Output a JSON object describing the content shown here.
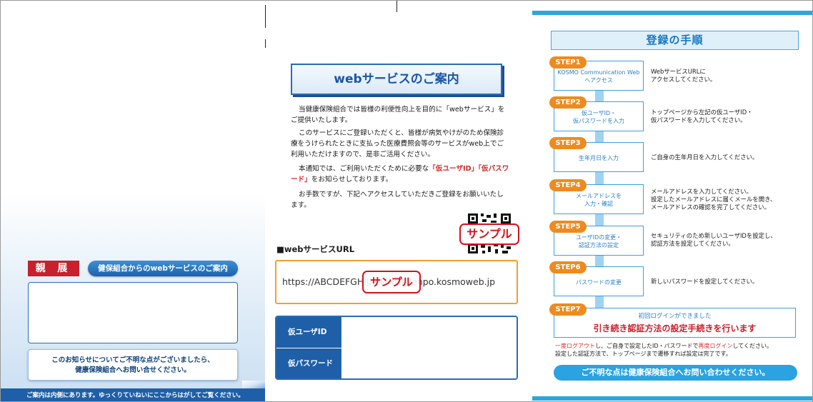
{
  "left_panel": {
    "addressee": "親 展",
    "title_badge": "健保組合からのwebサービスのご案内",
    "notice_line1": "このお知らせについてご不明な点がございましたら、",
    "notice_line2": "健康保険組合へお問い合せください。",
    "footer": "ご案内は内側にあります。ゆっくりていねいにここからはがしてご覧ください。"
  },
  "middle_panel": {
    "title": "webサービスのご案内",
    "paragraph1": "当健康保険組合では皆様の利便性向上を目的に「webサービス」をご提供いたします。",
    "paragraph2": "このサービスにご登録いただくと、皆様が病気やけがのため保険診療をうけられたときに支払った医療費照会等のサービスがweb上でご利用いただけますので、是非ご活用ください。",
    "paragraph3_before": "本通知では、ご利用いただくために必要な",
    "paragraph3_red1": "「仮ユーザID」",
    "paragraph3_red2": "「仮パスワード」",
    "paragraph3_after": "をお知らせしております。",
    "paragraph4": "お手数ですが、下記へアクセスしていただきご登録をお願いいたします。",
    "sample_stamp": "サンプル",
    "url_label": "■webサービスURL",
    "url_value": "https://ABCDEFGHIJKLMNOPkenpo.kosmoweb.jp",
    "temp_user_id_label": "仮ユーザID",
    "temp_password_label": "仮パスワード"
  },
  "right_panel": {
    "title": "登録の手順",
    "steps": [
      {
        "label": "STEP1",
        "box_line1": "KOSMO Communication Web",
        "box_line2": "へアクセス",
        "desc_line1": "WebサービスURLに",
        "desc_line2": "アクセスしてください。",
        "desc_line3": ""
      },
      {
        "label": "STEP2",
        "box_line1": "仮ユーザID・",
        "box_line2": "仮パスワードを入力",
        "desc_line1": "トップページから左記の仮ユーザID・",
        "desc_line2": "仮パスワードを入力してください。",
        "desc_line3": ""
      },
      {
        "label": "STEP3",
        "box_line1": "生年月日を入力",
        "box_line2": "",
        "desc_line1": "ご自身の生年月日を入力してください。",
        "desc_line2": "",
        "desc_line3": ""
      },
      {
        "label": "STEP4",
        "box_line1": "メールアドレスを",
        "box_line2": "入力・確認",
        "desc_line1": "メールアドレスを入力してください。",
        "desc_line2": "設定したメールアドレスに届くメールを開き、",
        "desc_line3": "メールアドレスの確認を完了してください。"
      },
      {
        "label": "STEP5",
        "box_line1": "ユーザIDの変更・",
        "box_line2": "認証方法の設定",
        "desc_line1": "セキュリティのため新しいユーザIDを設定し、",
        "desc_line2": "認証方法を設定してください。",
        "desc_line3": ""
      },
      {
        "label": "STEP6",
        "box_line1": "パスワードの変更",
        "box_line2": "",
        "desc_line1": "新しいパスワードを設定してください。",
        "desc_line2": "",
        "desc_line3": ""
      }
    ],
    "step7_label": "STEP7",
    "step7_small": "初回ログインができました",
    "step7_big": "引き続き認証方法の設定手続きを行います",
    "note_red1": "一度ログアウト",
    "note_mid": "し、ご自身で設定したID・パスワードで",
    "note_red2": "再度ログイン",
    "note_end": "してください。",
    "note_line2": "設定した認証方法で、トップページまで遷移すれば設定は完了です。",
    "footer": "ご不明な点は健康保険組合へお問い合わせください。"
  }
}
